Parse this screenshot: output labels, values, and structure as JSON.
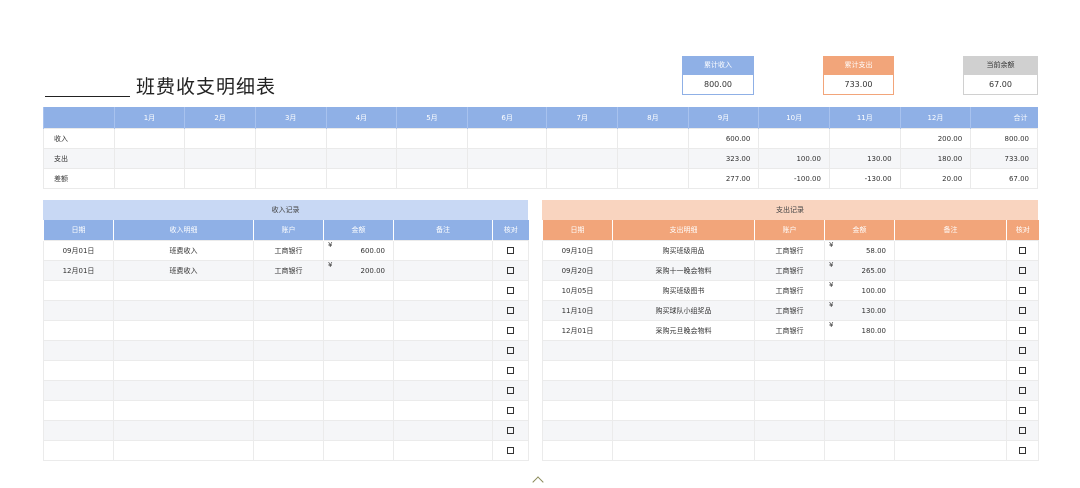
{
  "title": "班费收支明细表",
  "summary": {
    "income": {
      "label": "累计收入",
      "value": "800.00"
    },
    "expense": {
      "label": "累计支出",
      "value": "733.00"
    },
    "balance": {
      "label": "当前余额",
      "value": "67.00"
    }
  },
  "monthly": {
    "headers": [
      "",
      "1月",
      "2月",
      "3月",
      "4月",
      "5月",
      "6月",
      "7月",
      "8月",
      "9月",
      "10月",
      "11月",
      "12月",
      "合计"
    ],
    "rows": [
      {
        "label": "收入",
        "cells": [
          "",
          "",
          "",
          "",
          "",
          "",
          "",
          "",
          "600.00",
          "",
          "",
          "200.00",
          "800.00"
        ]
      },
      {
        "label": "支出",
        "cells": [
          "",
          "",
          "",
          "",
          "",
          "",
          "",
          "",
          "323.00",
          "100.00",
          "130.00",
          "180.00",
          "733.00"
        ]
      },
      {
        "label": "差额",
        "cells": [
          "",
          "",
          "",
          "",
          "",
          "",
          "",
          "",
          "277.00",
          "-100.00",
          "-130.00",
          "20.00",
          "67.00"
        ]
      }
    ]
  },
  "income_records": {
    "title": "收入记录",
    "headers": [
      "日期",
      "收入明细",
      "账户",
      "金额",
      "备注",
      "核对"
    ],
    "currency_symbol": "¥",
    "rows": [
      {
        "date": "09月01日",
        "detail": "班费收入",
        "account": "工商银行",
        "amount": "600.00"
      },
      {
        "date": "12月01日",
        "detail": "班费收入",
        "account": "工商银行",
        "amount": "200.00"
      }
    ]
  },
  "expense_records": {
    "title": "支出记录",
    "headers": [
      "日期",
      "支出明细",
      "账户",
      "金额",
      "备注",
      "核对"
    ],
    "currency_symbol": "¥",
    "rows": [
      {
        "date": "09月10日",
        "detail": "购买班级用品",
        "account": "工商银行",
        "amount": "58.00"
      },
      {
        "date": "09月20日",
        "detail": "采购十一晚会物料",
        "account": "工商银行",
        "amount": "265.00"
      },
      {
        "date": "10月05日",
        "detail": "购买班级图书",
        "account": "工商银行",
        "amount": "100.00"
      },
      {
        "date": "11月10日",
        "detail": "购买球队小组奖品",
        "account": "工商银行",
        "amount": "130.00"
      },
      {
        "date": "12月01日",
        "detail": "采购元旦晚会物料",
        "account": "工商银行",
        "amount": "180.00"
      }
    ]
  },
  "colors": {
    "income_accent": "#8fb0e6",
    "expense_accent": "#f2a57a",
    "balance_accent": "#d0d0d0"
  }
}
